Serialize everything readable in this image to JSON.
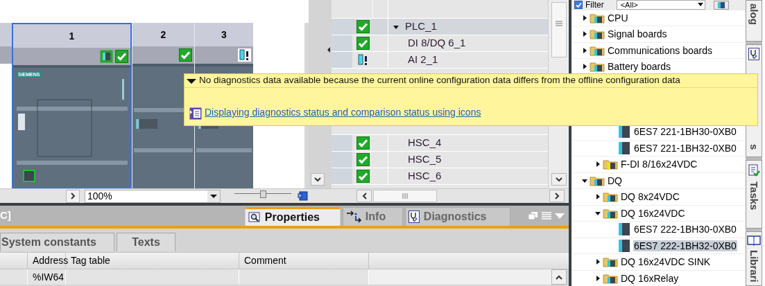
{
  "device_view": {
    "slots": [
      {
        "number": "1",
        "selected": true,
        "kind": "cpu",
        "badges": [
          {
            "kind": "module"
          },
          {
            "kind": "ok"
          }
        ]
      },
      {
        "number": "2",
        "selected": false,
        "kind": "io",
        "badges": [
          {
            "kind": "ok"
          }
        ]
      },
      {
        "number": "3",
        "selected": false,
        "kind": "io",
        "badges": [
          {
            "kind": "warning"
          }
        ]
      }
    ],
    "logo": "SIEMENS",
    "zoom": {
      "value": "100%",
      "level": 0.5
    }
  },
  "device_table": {
    "rows": [
      {
        "name": "PLC_1",
        "kind": "ok",
        "expanded": true,
        "selected": true,
        "children": [
          {
            "name": "DI 8/DQ 6_1",
            "kind": "ok",
            "selected": false
          },
          {
            "name": "AI 2_1",
            "kind": "warning",
            "selected": false
          },
          {
            "kind": "covered"
          },
          {
            "kind": "covered"
          },
          {
            "kind": "covered"
          },
          {
            "kind": "covered"
          },
          {
            "name": "HSC_4",
            "kind": "ok",
            "selected": false
          },
          {
            "name": "HSC_5",
            "kind": "ok",
            "selected": false
          },
          {
            "name": "HSC_6",
            "kind": "ok",
            "selected": false
          }
        ]
      }
    ]
  },
  "tooltip": {
    "message": "No diagnostics data available because the current online configuration data differs from the offline configuration data",
    "link": "Displaying diagnostics status and comparison status using icons"
  },
  "catalog": {
    "filter": {
      "label": "Filter",
      "checked": true,
      "value": "<All>"
    },
    "tree": [
      {
        "label": "CPU",
        "kind": "folder",
        "expanded": false,
        "selected": false
      },
      {
        "label": "Signal boards",
        "kind": "folder",
        "expanded": false,
        "selected": false
      },
      {
        "label": "Communications boards",
        "kind": "folder",
        "expanded": false,
        "selected": false
      },
      {
        "label": "Battery boards",
        "kind": "folder",
        "expanded": false,
        "selected": false
      },
      {
        "kind": "covered",
        "children": [
          {
            "kind": "covered"
          },
          {
            "kind": "covered",
            "children": [
              {
                "label": "6ES7 221-1BH30-0XB0",
                "kind": "module",
                "selected": false
              },
              {
                "label": "6ES7 221-1BH32-0XB0",
                "kind": "module",
                "selected": false
              }
            ]
          },
          {
            "label": "F-DI 8/16x24VDC",
            "kind": "safety-folder",
            "expanded": false,
            "selected": false
          }
        ]
      },
      {
        "label": "DQ",
        "kind": "folder",
        "expanded": true,
        "selected": false,
        "children": [
          {
            "label": "DQ 8x24VDC",
            "kind": "folder",
            "expanded": false,
            "selected": false
          },
          {
            "label": "DQ 16x24VDC",
            "kind": "folder",
            "expanded": true,
            "selected": false,
            "children": [
              {
                "label": "6ES7 222-1BH30-0XB0",
                "kind": "module",
                "selected": false
              },
              {
                "label": "6ES7 222-1BH32-0XB0",
                "kind": "module",
                "selected": true
              }
            ]
          },
          {
            "label": "DQ 16x24VDC SINK",
            "kind": "folder",
            "expanded": false,
            "selected": false
          },
          {
            "label": "DQ 16xRelay",
            "kind": "folder",
            "expanded": false,
            "selected": false
          }
        ]
      }
    ]
  },
  "side_tabs": [
    {
      "label": "alog"
    },
    {
      "label": "s"
    },
    {
      "label": "Tasks"
    },
    {
      "label": "Librari"
    }
  ],
  "inspector": {
    "title": "C]",
    "tabs": [
      {
        "label": "Properties",
        "selected": true
      },
      {
        "label": "Info",
        "selected": false
      },
      {
        "label": "Diagnostics",
        "selected": false
      }
    ],
    "subtabs": [
      {
        "label": "System constants",
        "selected": false
      },
      {
        "label": "Texts",
        "selected": false
      }
    ],
    "columns": [
      "Address",
      "Tag table",
      "Comment"
    ],
    "rows": [
      {
        "address": "%IW64"
      }
    ]
  }
}
